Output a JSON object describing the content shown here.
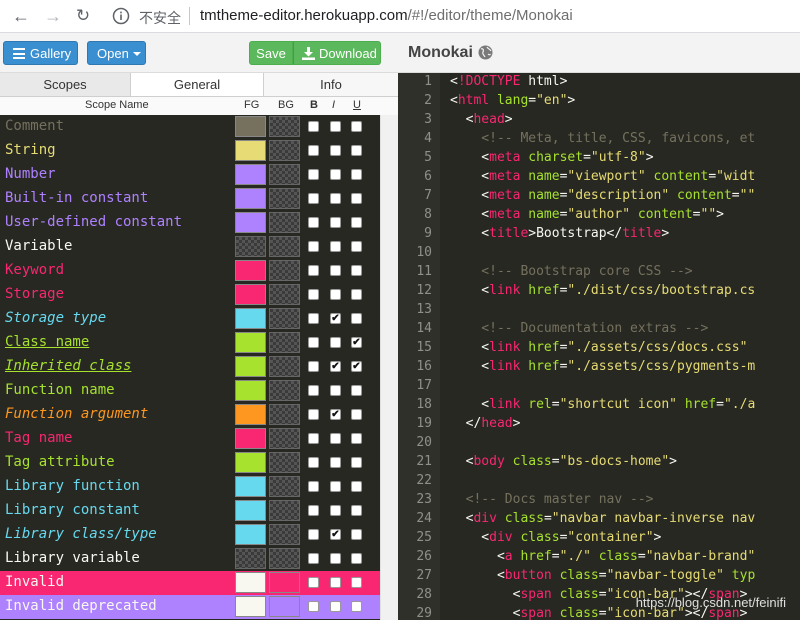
{
  "browser": {
    "insecure_label": "不安全",
    "url_host": "tmtheme-editor.herokuapp.com",
    "url_path": "/#!/editor/theme/Monokai"
  },
  "toolbar": {
    "gallery_label": "Gallery",
    "open_label": "Open",
    "save_label": "Save",
    "download_label": "Download",
    "gallery_color": "#3a8fd0",
    "save_color": "#5cb85c"
  },
  "tabs": [
    {
      "label": "Scopes",
      "active": true
    },
    {
      "label": "General",
      "active": false
    },
    {
      "label": "Info",
      "active": false
    }
  ],
  "table_header": {
    "name": "Scope Name",
    "fg": "FG",
    "bg": "BG",
    "b": "B",
    "i": "I",
    "u": "U"
  },
  "scopes": [
    {
      "name": "Comment",
      "text_color": "#75715e",
      "fg": "#75715e",
      "bg": null,
      "bg_fill": null,
      "b": false,
      "i": false,
      "u": false,
      "style": ""
    },
    {
      "name": "String",
      "text_color": "#e6db74",
      "fg": "#e6db74",
      "bg": null,
      "bg_fill": null,
      "b": false,
      "i": false,
      "u": false,
      "style": ""
    },
    {
      "name": "Number",
      "text_color": "#ae81ff",
      "fg": "#ae81ff",
      "bg": null,
      "bg_fill": null,
      "b": false,
      "i": false,
      "u": false,
      "style": ""
    },
    {
      "name": "Built-in constant",
      "text_color": "#ae81ff",
      "fg": "#ae81ff",
      "bg": null,
      "bg_fill": null,
      "b": false,
      "i": false,
      "u": false,
      "style": ""
    },
    {
      "name": "User-defined constant",
      "text_color": "#ae81ff",
      "fg": "#ae81ff",
      "bg": null,
      "bg_fill": null,
      "b": false,
      "i": false,
      "u": false,
      "style": ""
    },
    {
      "name": "Variable",
      "text_color": "#f8f8f2",
      "fg": null,
      "bg": null,
      "bg_fill": null,
      "b": false,
      "i": false,
      "u": false,
      "style": ""
    },
    {
      "name": "Keyword",
      "text_color": "#f92672",
      "fg": "#f92672",
      "bg": null,
      "bg_fill": null,
      "b": false,
      "i": false,
      "u": false,
      "style": ""
    },
    {
      "name": "Storage",
      "text_color": "#f92672",
      "fg": "#f92672",
      "bg": null,
      "bg_fill": null,
      "b": false,
      "i": false,
      "u": false,
      "style": ""
    },
    {
      "name": "Storage type",
      "text_color": "#66d9ef",
      "fg": "#66d9ef",
      "bg": null,
      "bg_fill": null,
      "b": false,
      "i": true,
      "u": false,
      "style": "italic"
    },
    {
      "name": "Class name",
      "text_color": "#a6e22e",
      "fg": "#a6e22e",
      "bg": null,
      "bg_fill": null,
      "b": false,
      "i": false,
      "u": true,
      "style": "underline"
    },
    {
      "name": "Inherited class",
      "text_color": "#a6e22e",
      "fg": "#a6e22e",
      "bg": null,
      "bg_fill": null,
      "b": false,
      "i": true,
      "u": true,
      "style": "italic underline"
    },
    {
      "name": "Function name",
      "text_color": "#a6e22e",
      "fg": "#a6e22e",
      "bg": null,
      "bg_fill": null,
      "b": false,
      "i": false,
      "u": false,
      "style": ""
    },
    {
      "name": "Function argument",
      "text_color": "#fd971f",
      "fg": "#fd971f",
      "bg": null,
      "bg_fill": null,
      "b": false,
      "i": true,
      "u": false,
      "style": "italic"
    },
    {
      "name": "Tag name",
      "text_color": "#f92672",
      "fg": "#f92672",
      "bg": null,
      "bg_fill": null,
      "b": false,
      "i": false,
      "u": false,
      "style": ""
    },
    {
      "name": "Tag attribute",
      "text_color": "#a6e22e",
      "fg": "#a6e22e",
      "bg": null,
      "bg_fill": null,
      "b": false,
      "i": false,
      "u": false,
      "style": ""
    },
    {
      "name": "Library function",
      "text_color": "#66d9ef",
      "fg": "#66d9ef",
      "bg": null,
      "bg_fill": null,
      "b": false,
      "i": false,
      "u": false,
      "style": ""
    },
    {
      "name": "Library constant",
      "text_color": "#66d9ef",
      "fg": "#66d9ef",
      "bg": null,
      "bg_fill": null,
      "b": false,
      "i": false,
      "u": false,
      "style": ""
    },
    {
      "name": "Library class/type",
      "text_color": "#66d9ef",
      "fg": "#66d9ef",
      "bg": null,
      "bg_fill": null,
      "b": false,
      "i": true,
      "u": false,
      "style": "italic"
    },
    {
      "name": "Library variable",
      "text_color": "#f8f8f2",
      "fg": null,
      "bg": null,
      "bg_fill": null,
      "b": false,
      "i": false,
      "u": false,
      "style": ""
    },
    {
      "name": "Invalid",
      "text_color": "#f8f8f0",
      "fg": "#f8f8f0",
      "bg": "#f92672",
      "bg_fill": "#f92672",
      "b": false,
      "i": false,
      "u": false,
      "style": ""
    },
    {
      "name": "Invalid deprecated",
      "text_color": "#f8f8f0",
      "fg": "#f8f8f0",
      "bg": "#ae81ff",
      "bg_fill": "#ae81ff",
      "b": false,
      "i": false,
      "u": false,
      "style": ""
    }
  ],
  "editor": {
    "title": "Monokai",
    "lines": [
      {
        "n": "1",
        "tokens": [
          [
            "t-txt",
            "<"
          ],
          [
            "t-tag",
            "!DOCTYPE"
          ],
          [
            "t-txt",
            " html>"
          ]
        ]
      },
      {
        "n": "2",
        "tokens": [
          [
            "t-txt",
            "<"
          ],
          [
            "t-tag",
            "html"
          ],
          [
            "t-txt",
            " "
          ],
          [
            "t-attr",
            "lang"
          ],
          [
            "t-txt",
            "="
          ],
          [
            "t-str",
            "\"en\""
          ],
          [
            "t-txt",
            ">"
          ]
        ]
      },
      {
        "n": "3",
        "tokens": [
          [
            "t-txt",
            "  <"
          ],
          [
            "t-tag",
            "head"
          ],
          [
            "t-txt",
            ">"
          ]
        ]
      },
      {
        "n": "4",
        "tokens": [
          [
            "t-com",
            "    <!-- Meta, title, CSS, favicons, et"
          ]
        ]
      },
      {
        "n": "5",
        "tokens": [
          [
            "t-txt",
            "    <"
          ],
          [
            "t-tag",
            "meta"
          ],
          [
            "t-txt",
            " "
          ],
          [
            "t-attr",
            "charset"
          ],
          [
            "t-txt",
            "="
          ],
          [
            "t-str",
            "\"utf-8\""
          ],
          [
            "t-txt",
            ">"
          ]
        ]
      },
      {
        "n": "6",
        "tokens": [
          [
            "t-txt",
            "    <"
          ],
          [
            "t-tag",
            "meta"
          ],
          [
            "t-txt",
            " "
          ],
          [
            "t-attr",
            "name"
          ],
          [
            "t-txt",
            "="
          ],
          [
            "t-str",
            "\"viewport\""
          ],
          [
            "t-txt",
            " "
          ],
          [
            "t-attr",
            "content"
          ],
          [
            "t-txt",
            "="
          ],
          [
            "t-str",
            "\"widt"
          ]
        ]
      },
      {
        "n": "7",
        "tokens": [
          [
            "t-txt",
            "    <"
          ],
          [
            "t-tag",
            "meta"
          ],
          [
            "t-txt",
            " "
          ],
          [
            "t-attr",
            "name"
          ],
          [
            "t-txt",
            "="
          ],
          [
            "t-str",
            "\"description\""
          ],
          [
            "t-txt",
            " "
          ],
          [
            "t-attr",
            "content"
          ],
          [
            "t-txt",
            "="
          ],
          [
            "t-str",
            "\"\""
          ]
        ]
      },
      {
        "n": "8",
        "tokens": [
          [
            "t-txt",
            "    <"
          ],
          [
            "t-tag",
            "meta"
          ],
          [
            "t-txt",
            " "
          ],
          [
            "t-attr",
            "name"
          ],
          [
            "t-txt",
            "="
          ],
          [
            "t-str",
            "\"author\""
          ],
          [
            "t-txt",
            " "
          ],
          [
            "t-attr",
            "content"
          ],
          [
            "t-txt",
            "="
          ],
          [
            "t-str",
            "\"\""
          ],
          [
            "t-txt",
            ">"
          ]
        ]
      },
      {
        "n": "9",
        "tokens": [
          [
            "t-txt",
            "    <"
          ],
          [
            "t-tag",
            "title"
          ],
          [
            "t-txt",
            ">Bootstrap</"
          ],
          [
            "t-tag",
            "title"
          ],
          [
            "t-txt",
            ">"
          ]
        ]
      },
      {
        "n": "10",
        "tokens": []
      },
      {
        "n": "11",
        "tokens": [
          [
            "t-com",
            "    <!-- Bootstrap core CSS -->"
          ]
        ]
      },
      {
        "n": "12",
        "tokens": [
          [
            "t-txt",
            "    <"
          ],
          [
            "t-tag",
            "link"
          ],
          [
            "t-txt",
            " "
          ],
          [
            "t-attr",
            "href"
          ],
          [
            "t-txt",
            "="
          ],
          [
            "t-str",
            "\"./dist/css/bootstrap.cs"
          ]
        ]
      },
      {
        "n": "13",
        "tokens": []
      },
      {
        "n": "14",
        "tokens": [
          [
            "t-com",
            "    <!-- Documentation extras -->"
          ]
        ]
      },
      {
        "n": "15",
        "tokens": [
          [
            "t-txt",
            "    <"
          ],
          [
            "t-tag",
            "link"
          ],
          [
            "t-txt",
            " "
          ],
          [
            "t-attr",
            "href"
          ],
          [
            "t-txt",
            "="
          ],
          [
            "t-str",
            "\"./assets/css/docs.css\""
          ]
        ]
      },
      {
        "n": "16",
        "tokens": [
          [
            "t-txt",
            "    <"
          ],
          [
            "t-tag",
            "link"
          ],
          [
            "t-txt",
            " "
          ],
          [
            "t-attr",
            "href"
          ],
          [
            "t-txt",
            "="
          ],
          [
            "t-str",
            "\"./assets/css/pygments-m"
          ]
        ]
      },
      {
        "n": "17",
        "tokens": []
      },
      {
        "n": "18",
        "tokens": [
          [
            "t-txt",
            "    <"
          ],
          [
            "t-tag",
            "link"
          ],
          [
            "t-txt",
            " "
          ],
          [
            "t-attr",
            "rel"
          ],
          [
            "t-txt",
            "="
          ],
          [
            "t-str",
            "\"shortcut icon\""
          ],
          [
            "t-txt",
            " "
          ],
          [
            "t-attr",
            "href"
          ],
          [
            "t-txt",
            "="
          ],
          [
            "t-str",
            "\"./a"
          ]
        ]
      },
      {
        "n": "19",
        "tokens": [
          [
            "t-txt",
            "  </"
          ],
          [
            "t-tag",
            "head"
          ],
          [
            "t-txt",
            ">"
          ]
        ]
      },
      {
        "n": "20",
        "tokens": []
      },
      {
        "n": "21",
        "tokens": [
          [
            "t-txt",
            "  <"
          ],
          [
            "t-tag",
            "body"
          ],
          [
            "t-txt",
            " "
          ],
          [
            "t-attr",
            "class"
          ],
          [
            "t-txt",
            "="
          ],
          [
            "t-str",
            "\"bs-docs-home\""
          ],
          [
            "t-txt",
            ">"
          ]
        ]
      },
      {
        "n": "22",
        "tokens": []
      },
      {
        "n": "23",
        "tokens": [
          [
            "t-com",
            "  <!-- Docs master nav -->"
          ]
        ]
      },
      {
        "n": "24",
        "tokens": [
          [
            "t-txt",
            "  <"
          ],
          [
            "t-tag",
            "div"
          ],
          [
            "t-txt",
            " "
          ],
          [
            "t-attr",
            "class"
          ],
          [
            "t-txt",
            "="
          ],
          [
            "t-str",
            "\"navbar navbar-inverse nav"
          ]
        ]
      },
      {
        "n": "25",
        "tokens": [
          [
            "t-txt",
            "    <"
          ],
          [
            "t-tag",
            "div"
          ],
          [
            "t-txt",
            " "
          ],
          [
            "t-attr",
            "class"
          ],
          [
            "t-txt",
            "="
          ],
          [
            "t-str",
            "\"container\""
          ],
          [
            "t-txt",
            ">"
          ]
        ]
      },
      {
        "n": "26",
        "tokens": [
          [
            "t-txt",
            "      <"
          ],
          [
            "t-tag",
            "a"
          ],
          [
            "t-txt",
            " "
          ],
          [
            "t-attr",
            "href"
          ],
          [
            "t-txt",
            "="
          ],
          [
            "t-str",
            "\"./\""
          ],
          [
            "t-txt",
            " "
          ],
          [
            "t-attr",
            "class"
          ],
          [
            "t-txt",
            "="
          ],
          [
            "t-str",
            "\"navbar-brand\""
          ]
        ]
      },
      {
        "n": "27",
        "tokens": [
          [
            "t-txt",
            "      <"
          ],
          [
            "t-tag",
            "button"
          ],
          [
            "t-txt",
            " "
          ],
          [
            "t-attr",
            "class"
          ],
          [
            "t-txt",
            "="
          ],
          [
            "t-str",
            "\"navbar-toggle\""
          ],
          [
            "t-txt",
            " "
          ],
          [
            "t-attr",
            "typ"
          ]
        ]
      },
      {
        "n": "28",
        "tokens": [
          [
            "t-txt",
            "        <"
          ],
          [
            "t-tag",
            "span"
          ],
          [
            "t-txt",
            " "
          ],
          [
            "t-attr",
            "class"
          ],
          [
            "t-txt",
            "="
          ],
          [
            "t-str",
            "\"icon-bar\""
          ],
          [
            "t-txt",
            "></"
          ],
          [
            "t-tag",
            "span"
          ],
          [
            "t-txt",
            ">"
          ]
        ]
      },
      {
        "n": "29",
        "tokens": [
          [
            "t-txt",
            "        <"
          ],
          [
            "t-tag",
            "span"
          ],
          [
            "t-txt",
            " "
          ],
          [
            "t-attr",
            "class"
          ],
          [
            "t-txt",
            "="
          ],
          [
            "t-str",
            "\"icon-bar\""
          ],
          [
            "t-txt",
            "></"
          ],
          [
            "t-tag",
            "span"
          ],
          [
            "t-txt",
            ">"
          ]
        ]
      }
    ]
  },
  "watermark": "https://blog.csdn.net/feinifi"
}
